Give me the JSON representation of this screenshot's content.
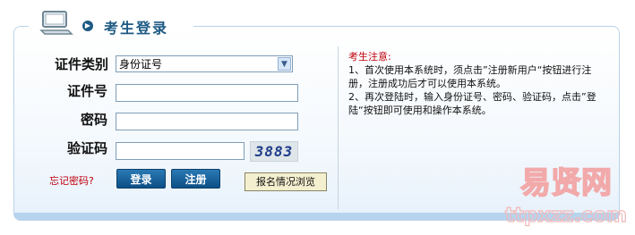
{
  "header": {
    "title": "考生登录"
  },
  "form": {
    "id_type_label": "证件类别",
    "id_type_value": "身份证号",
    "id_number_label": "证件号",
    "password_label": "密码",
    "captcha_label": "验证码",
    "captcha_text": "3883",
    "forgot_link": "忘记密码?",
    "login_button": "登录",
    "register_button": "注册",
    "browse_button": "报名情况浏览"
  },
  "notice": {
    "title": "考生注意:",
    "line1": "1、首次使用本系统时，须点击”注册新用户“按钮进行注册，注册成功后才可以使用本系统。",
    "line2": "2、再次登陆时，输入身份证号、密码、验证码，点击”登陆“按钮即可使用和操作本系统。"
  },
  "watermark": {
    "main": "易贤网",
    "sub": "ttpxzz.com"
  },
  "colors": {
    "accent": "#1c5a84",
    "warning": "#c0000c",
    "panel_border": "#b9d3ea"
  }
}
